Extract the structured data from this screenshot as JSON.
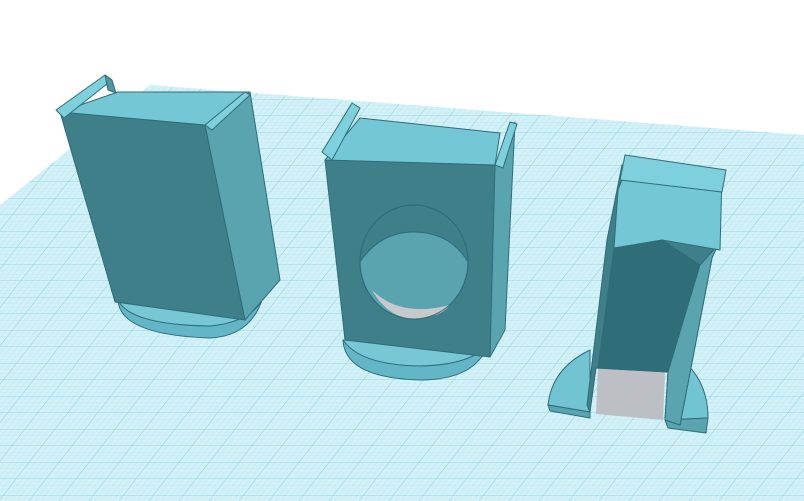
{
  "app": {
    "view": "3D workplane",
    "grid_visible": true,
    "shape_color": "#72c4d3",
    "grid_color": "#9fdcec",
    "grid_fill": "#d4f1f8"
  },
  "objects": [
    {
      "name": "solid-block-stand"
    },
    {
      "name": "stand-with-circular-hole"
    },
    {
      "name": "stand-with-arched-opening"
    }
  ]
}
